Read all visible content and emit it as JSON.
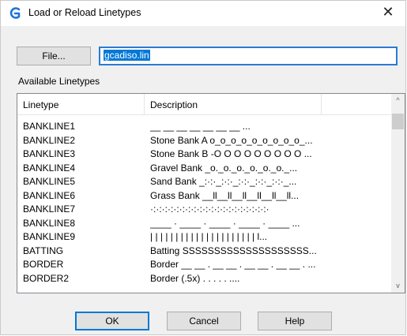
{
  "window": {
    "title": "Load or Reload Linetypes",
    "close_glyph": "✕",
    "icon": "app-logo-icon",
    "accent_color": "#0078d7"
  },
  "file": {
    "button_label": "File...",
    "path_value": "gcadiso.lin"
  },
  "list": {
    "section_label": "Available Linetypes",
    "columns": [
      "Linetype",
      "Description"
    ],
    "rows": [
      {
        "name": "BANKLINE1",
        "description": "__ __ __ __ __ __ __ ..."
      },
      {
        "name": "BANKLINE2",
        "description": "Stone Bank A o_o_o_o_o_o_o_o_o_..."
      },
      {
        "name": "BANKLINE3",
        "description": "Stone Bank B -O O O O O O O O O ..."
      },
      {
        "name": "BANKLINE4",
        "description": "Gravel Bank _o._o._o._o._o._o._..."
      },
      {
        "name": "BANKLINE5",
        "description": "Sand Bank _:·:·_:·:·_:·:·_:·:·_:·:·_..."
      },
      {
        "name": "BANKLINE6",
        "description": "Grass Bank __ll__ll__ll__ll__ll__ll..."
      },
      {
        "name": "BANKLINE7",
        "description": "·:·:·:·:·:·:·:·:·:·:·:·:·:·:·:·:·:·:·:·:·"
      },
      {
        "name": "BANKLINE8",
        "description": "____ · ____ · ____ · ____ · ____ ..."
      },
      {
        "name": "BANKLINE9",
        "description": "| | | | | | | | | | | | | | | | | | | | | l..."
      },
      {
        "name": "BATTING",
        "description": "Batting SSSSSSSSSSSSSSSSSSSS..."
      },
      {
        "name": "BORDER",
        "description": "Border __ __ . __ __ . __ __ . __ __ . ..."
      },
      {
        "name": "BORDER2",
        "description": "Border (.5x) . . . . . ...."
      }
    ]
  },
  "buttons": {
    "ok": "OK",
    "cancel": "Cancel",
    "help": "Help"
  },
  "scrollbar": {
    "up_glyph": "^",
    "down_glyph": "v"
  }
}
